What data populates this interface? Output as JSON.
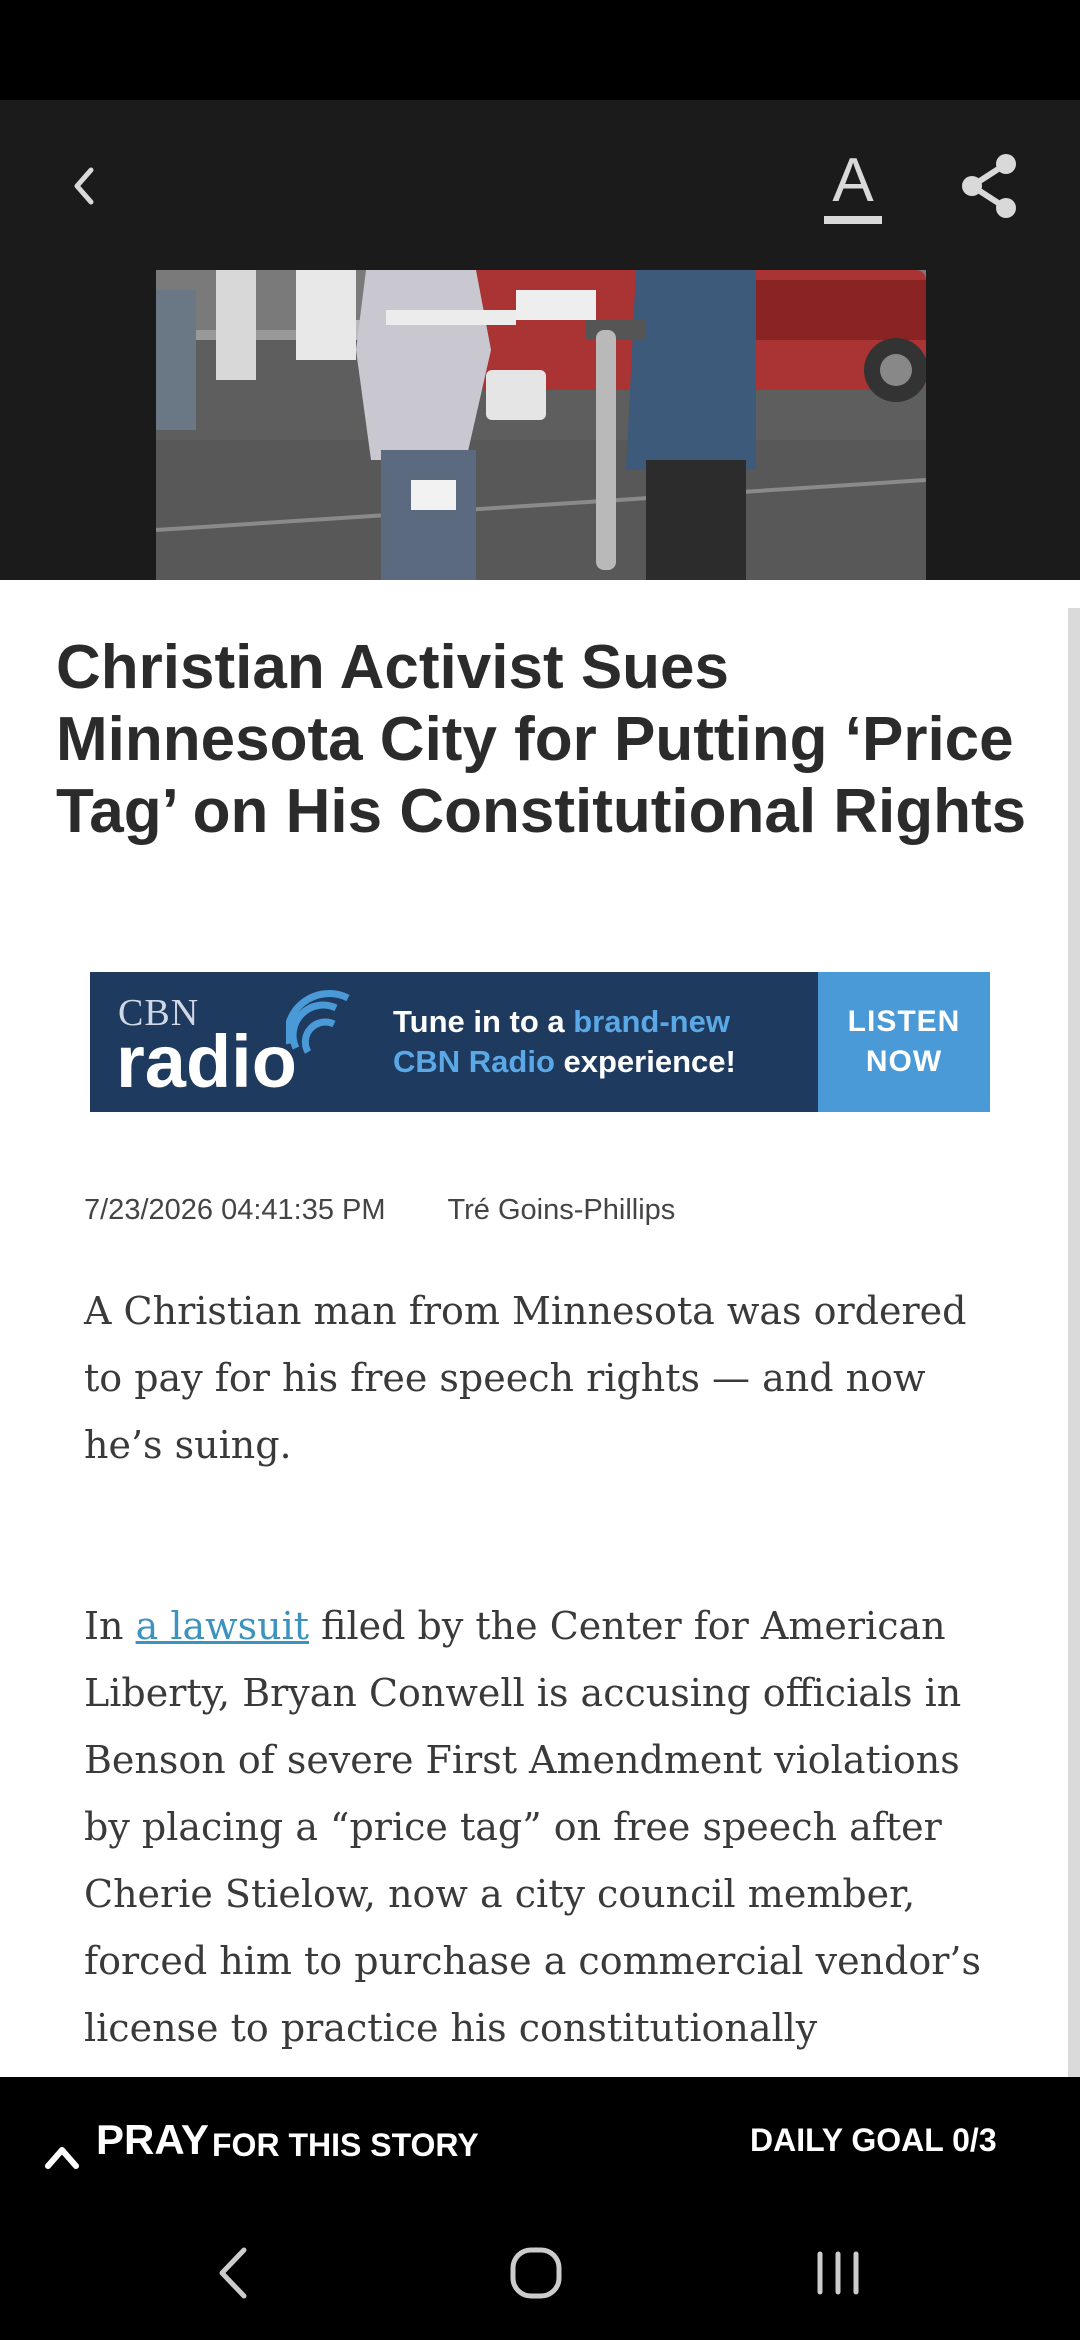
{
  "toolbar": {
    "back_icon": "chevron-left-icon",
    "font_size_glyph": "A",
    "share_icon": "share-icon"
  },
  "hero_image": {
    "description_icon": "photo"
  },
  "article": {
    "headline": "Christian Activist Sues Minnesota City for Putting ‘Price Tag’ on His Constitutional Rights",
    "date": "7/23/2026 04:41:35 PM",
    "author": "Tré Goins-Phillips",
    "paragraph_1": "A Christian man from Minnesota was ordered to pay for his free speech rights — and now he’s suing.",
    "paragraph_2_prefix": "In ",
    "paragraph_2_link": "a lawsuit",
    "paragraph_2_body": " filed by the Center for American Liberty, Bryan Conwell is accusing officials in Benson of severe First Amendment violations by placing a “price tag” on free speech after Cherie Stielow, now a city council member, forced him to purchase a commercial vendor’s license to practice his constitutionally protected right to free speech at the city’s"
  },
  "banner": {
    "logo_small": "CBN",
    "logo_large": "radio",
    "tagline_1": "Tune in to a ",
    "tagline_highlight": "brand-new",
    "tagline_2": "CBN Radio",
    "tagline_3": " experience!",
    "cta_line_1": "LISTEN",
    "cta_line_2": "NOW"
  },
  "pray_bar": {
    "label_main": "PRAY",
    "label_rest": "FOR THIS STORY",
    "daily_goal": "DAILY GOAL 0/3"
  },
  "colors": {
    "link": "#3d93bf",
    "banner_bg": "#1f3a5f",
    "banner_cta": "#4a9ad8"
  }
}
